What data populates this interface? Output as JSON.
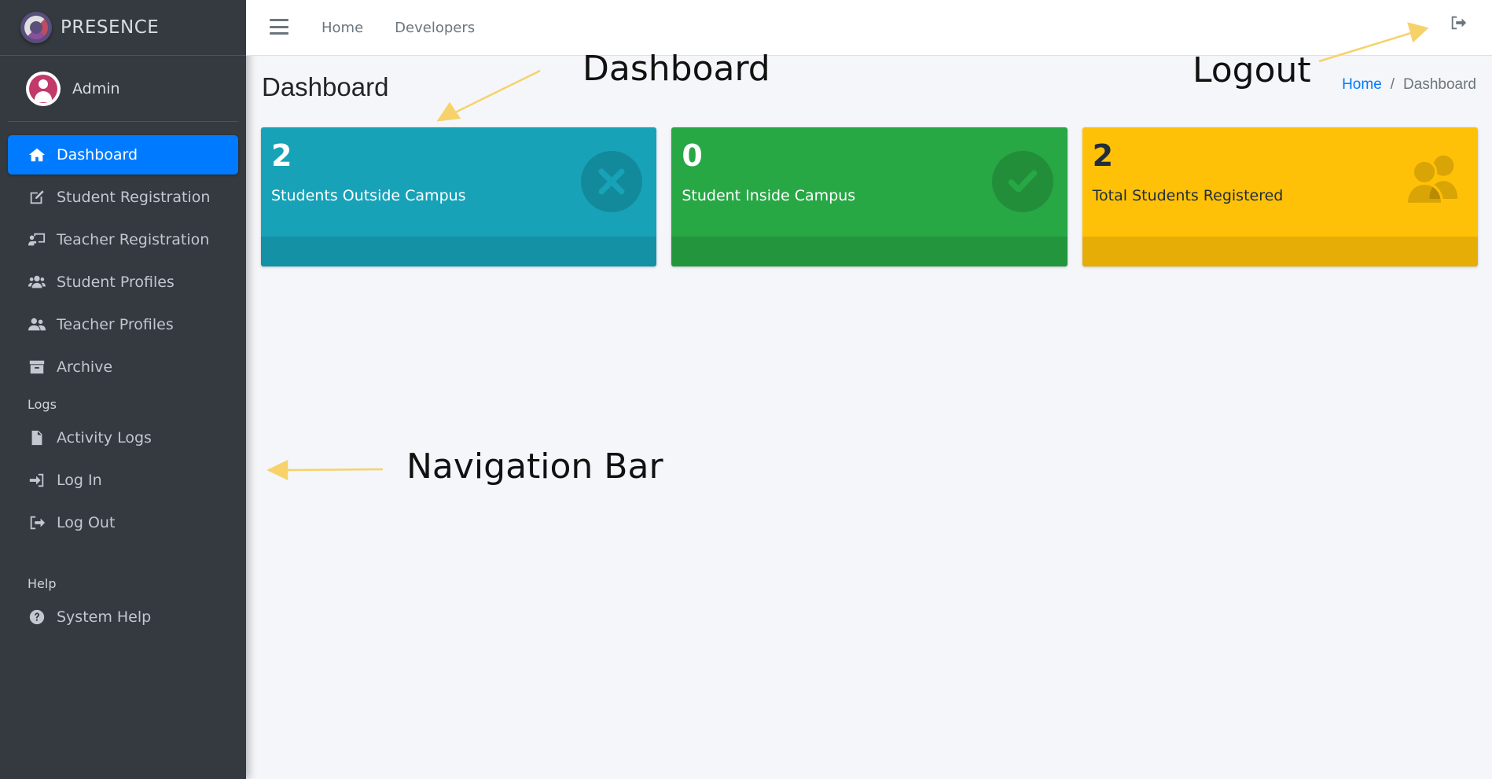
{
  "brand": {
    "name": "PRESENCE"
  },
  "user": {
    "name": "Admin"
  },
  "sidebar": {
    "items": [
      {
        "label": "Dashboard",
        "icon": "home-icon",
        "active": true
      },
      {
        "label": "Student Registration",
        "icon": "edit-icon"
      },
      {
        "label": "Teacher Registration",
        "icon": "chalkboard-teacher-icon"
      },
      {
        "label": "Student Profiles",
        "icon": "users-icon"
      },
      {
        "label": "Teacher Profiles",
        "icon": "user-friends-icon"
      },
      {
        "label": "Archive",
        "icon": "archive-icon"
      }
    ],
    "logs_header": "Logs",
    "logs_items": [
      {
        "label": "Activity Logs",
        "icon": "file-icon"
      },
      {
        "label": "Log In",
        "icon": "sign-in-icon"
      },
      {
        "label": "Log Out",
        "icon": "sign-out-icon"
      }
    ],
    "help_header": "Help",
    "help_items": [
      {
        "label": "System Help",
        "icon": "question-circle-icon"
      }
    ]
  },
  "topbar": {
    "links": [
      "Home",
      "Developers"
    ],
    "logout_icon": "sign-out-icon"
  },
  "page": {
    "title": "Dashboard",
    "breadcrumb": {
      "home": "Home",
      "separator": "/",
      "current": "Dashboard"
    }
  },
  "cards": [
    {
      "value": "2",
      "label": "Students Outside Campus",
      "color": "#17a2b8",
      "icon": "times-circle-icon"
    },
    {
      "value": "0",
      "label": "Student Inside Campus",
      "color": "#28a745",
      "icon": "check-circle-icon"
    },
    {
      "value": "2",
      "label": "Total Students Registered",
      "color": "#ffc107",
      "icon": "users-icon"
    }
  ],
  "annotations": {
    "dashboard": "Dashboard",
    "logout": "Logout",
    "navigation_bar": "Navigation Bar",
    "arrow_color": "#f7d26a"
  }
}
